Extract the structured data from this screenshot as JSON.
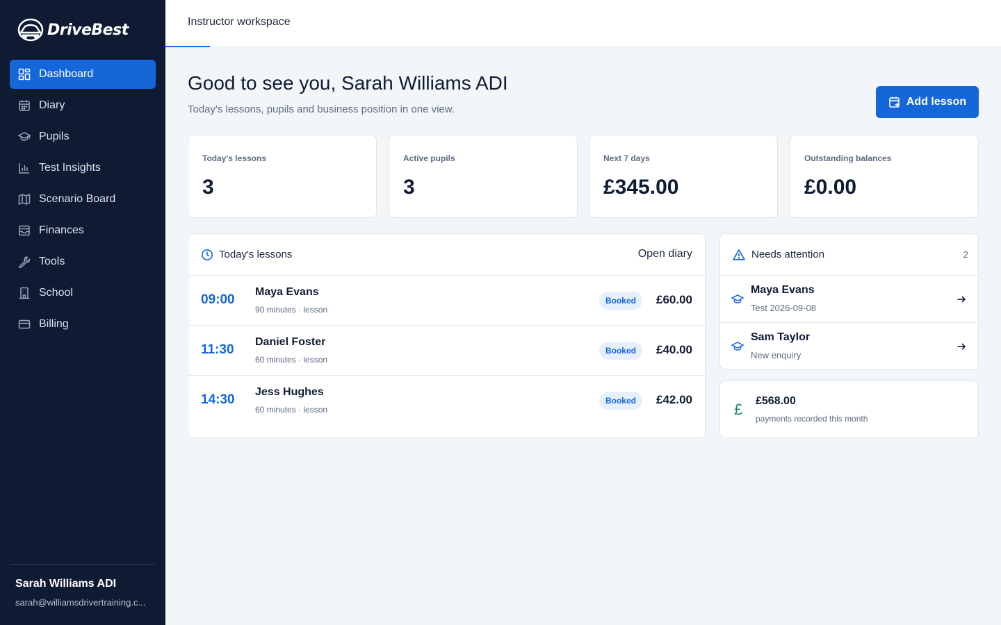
{
  "brand": {
    "name": "DriveBest",
    "logo_icon": "car-icon"
  },
  "sidebar": {
    "items": [
      {
        "label": "Dashboard",
        "icon": "dashboard-icon",
        "active": true
      },
      {
        "label": "Diary",
        "icon": "calendar-icon",
        "active": false
      },
      {
        "label": "Pupils",
        "icon": "graduation-cap-icon",
        "active": false
      },
      {
        "label": "Test Insights",
        "icon": "bar-chart-icon",
        "active": false
      },
      {
        "label": "Scenario Board",
        "icon": "map-icon",
        "active": false
      },
      {
        "label": "Finances",
        "icon": "wallet-icon",
        "active": false
      },
      {
        "label": "Tools",
        "icon": "wrench-icon",
        "active": false
      },
      {
        "label": "School",
        "icon": "building-icon",
        "active": false
      },
      {
        "label": "Billing",
        "icon": "credit-card-icon",
        "active": false
      }
    ],
    "user": {
      "name": "Sarah Williams ADI",
      "email": "sarah@williamsdrivertraining.c..."
    }
  },
  "topbar": {
    "tab": "Instructor workspace"
  },
  "header": {
    "greeting": "Good to see you, Sarah Williams ADI",
    "subtitle": "Today's lessons, pupils and business position in one view.",
    "add_button": "Add lesson"
  },
  "stats": [
    {
      "label": "Today's lessons",
      "value": "3"
    },
    {
      "label": "Active pupils",
      "value": "3"
    },
    {
      "label": "Next 7 days",
      "value": "£345.00"
    },
    {
      "label": "Outstanding balances",
      "value": "£0.00"
    }
  ],
  "lessons": {
    "title": "Today's lessons",
    "open_diary": "Open diary",
    "rows": [
      {
        "time": "09:00",
        "pupil": "Maya Evans",
        "meta": "90 minutes · lesson",
        "status": "Booked",
        "price": "£60.00"
      },
      {
        "time": "11:30",
        "pupil": "Daniel Foster",
        "meta": "60 minutes · lesson",
        "status": "Booked",
        "price": "£40.00"
      },
      {
        "time": "14:30",
        "pupil": "Jess Hughes",
        "meta": "60 minutes · lesson",
        "status": "Booked",
        "price": "£42.00"
      }
    ]
  },
  "attention": {
    "title": "Needs attention",
    "count": "2",
    "items": [
      {
        "name": "Maya Evans",
        "detail": "Test 2026-09-08"
      },
      {
        "name": "Sam Taylor",
        "detail": "New enquiry"
      }
    ]
  },
  "payments": {
    "symbol": "£",
    "amount": "£568.00",
    "caption": "payments recorded this month"
  },
  "colors": {
    "sidebar_bg": "#0f1b33",
    "accent": "#1466d9",
    "page_bg": "#f3f6f9",
    "money_green": "#1e8a5a"
  }
}
